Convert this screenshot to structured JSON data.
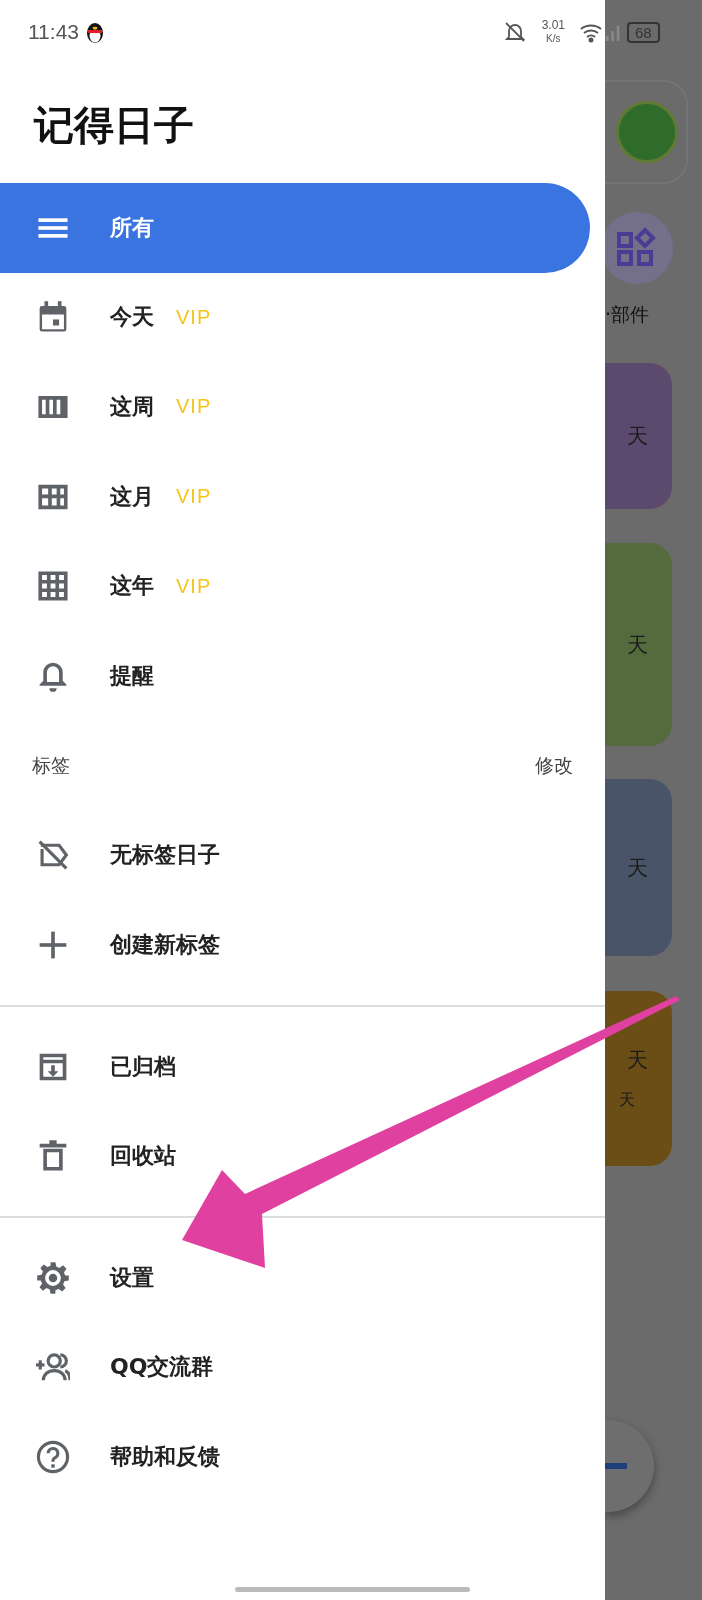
{
  "status_bar": {
    "time": "11:43",
    "net_speed": [
      "3.01",
      "K/s"
    ],
    "battery": "68"
  },
  "drawer": {
    "title": "记得日子",
    "groups": [
      {
        "divider_before": false,
        "items": [
          {
            "label": "所有",
            "selected": true
          },
          {
            "label": "今天",
            "badge": "VIP",
            "selected": false
          },
          {
            "label": "这周",
            "badge": "VIP",
            "selected": false
          },
          {
            "label": "这月",
            "badge": "VIP",
            "selected": false
          },
          {
            "label": "这年",
            "badge": "VIP",
            "selected": false
          },
          {
            "label": "提醒",
            "selected": false
          }
        ]
      },
      {
        "divider_before": false,
        "header": {
          "label": "标签",
          "action": "修改"
        },
        "items": [
          {
            "label": "无标签日子",
            "selected": false
          },
          {
            "label": "创建新标签",
            "selected": false
          }
        ]
      },
      {
        "divider_before": true,
        "items": [
          {
            "label": "已归档",
            "selected": false
          },
          {
            "label": "回收站",
            "selected": false
          }
        ]
      },
      {
        "divider_before": true,
        "items": [
          {
            "label": "设置",
            "selected": false
          },
          {
            "label": "QQ交流群",
            "selected": false
          },
          {
            "label": "帮助和反馈",
            "selected": false
          }
        ]
      }
    ]
  },
  "background": {
    "widget_label": "·部件",
    "cards": [
      {
        "color": "#5c4a6e",
        "texts": [
          "天"
        ]
      },
      {
        "color": "#556b3e",
        "texts": [
          "天"
        ]
      },
      {
        "color": "#4a5468",
        "texts": [
          "天"
        ]
      },
      {
        "color": "#6b4d16",
        "texts": [
          "天",
          "天"
        ]
      }
    ]
  }
}
